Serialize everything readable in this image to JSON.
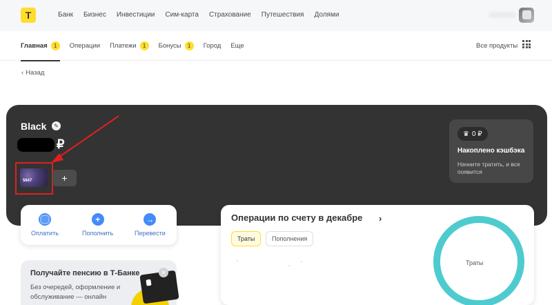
{
  "header": {
    "logo_letter": "Т",
    "nav": [
      "Банк",
      "Бизнес",
      "Инвестиции",
      "Сим-карта",
      "Страхование",
      "Путешествия",
      "Долями"
    ]
  },
  "subnav": {
    "tabs": [
      {
        "label": "Главная",
        "badge": "1"
      },
      {
        "label": "Операции",
        "badge": ""
      },
      {
        "label": "Платежи",
        "badge": "1"
      },
      {
        "label": "Бонусы",
        "badge": "1"
      },
      {
        "label": "Город",
        "badge": ""
      },
      {
        "label": "Еще",
        "badge": ""
      }
    ],
    "all_products": "Все продукты"
  },
  "back_label": "Назад",
  "account": {
    "title": "Black",
    "currency": "₽",
    "card_last4": "5647",
    "add_label": "+"
  },
  "cashback": {
    "amount": "0 ₽",
    "title": "Накоплено кэшбэка",
    "hint": "Начните тратить, и все появится"
  },
  "actions": [
    {
      "label": "Оплатить",
      "icon": "pay-icon"
    },
    {
      "label": "Пополнить",
      "icon": "plus-icon"
    },
    {
      "label": "Перевести",
      "icon": "arrow-right-icon"
    }
  ],
  "promo": {
    "title": "Получайте пенсию в Т-Банке",
    "text": "Без очередей, оформление и обслуживание — онлайн"
  },
  "operations": {
    "title": "Операции по счету в декабре",
    "chips": [
      "Траты",
      "Пополнения"
    ],
    "ring_label": "Траты"
  },
  "colors": {
    "accent_yellow": "#ffdd2d",
    "dark_card": "#333333",
    "action_blue": "#428bf9",
    "ring_teal": "#4ecbcf",
    "annotation_red": "#e02020"
  }
}
